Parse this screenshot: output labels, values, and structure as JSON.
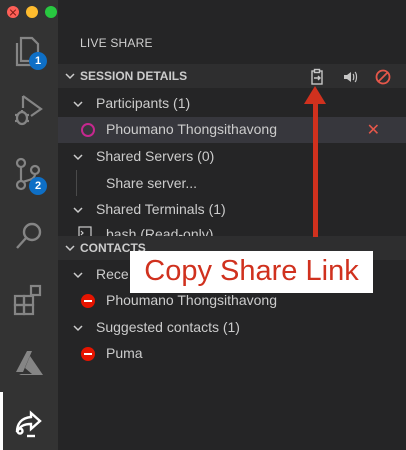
{
  "window": {
    "controls": [
      "close",
      "minimize",
      "maximize"
    ]
  },
  "activity_bar": {
    "items": [
      {
        "icon": "explorer-icon",
        "badge": "1"
      },
      {
        "icon": "run-debug-icon",
        "badge": null
      },
      {
        "icon": "source-control-icon",
        "badge": "2"
      },
      {
        "icon": "search-icon",
        "badge": null
      },
      {
        "icon": "extensions-icon",
        "badge": null
      },
      {
        "icon": "azure-icon",
        "badge": null
      },
      {
        "icon": "live-share-icon",
        "badge": null,
        "active": true
      }
    ]
  },
  "sidebar": {
    "title": "LIVE SHARE",
    "session_details": {
      "label": "SESSION DETAILS",
      "actions": [
        "copy-share-link-icon",
        "audio-icon",
        "stop-session-icon"
      ],
      "participants": {
        "label": "Participants (1)",
        "items": [
          {
            "name": "Phoumano Thongsithavong"
          }
        ]
      },
      "shared_servers": {
        "label": "Shared Servers (0)",
        "items": [
          {
            "name": "Share server..."
          }
        ]
      },
      "shared_terminals": {
        "label": "Shared Terminals (1)",
        "items": [
          {
            "name": "bash (Read-only)"
          }
        ]
      }
    },
    "contacts": {
      "label": "CONTACTS",
      "recent": {
        "label": "Rece",
        "items": [
          {
            "name": "Phoumano Thongsithavong"
          }
        ]
      },
      "suggested": {
        "label": "Suggested contacts (1)",
        "items": [
          {
            "name": "Puma"
          }
        ]
      }
    }
  },
  "annotation": {
    "text": "Copy Share Link",
    "color": "#d0311e"
  }
}
